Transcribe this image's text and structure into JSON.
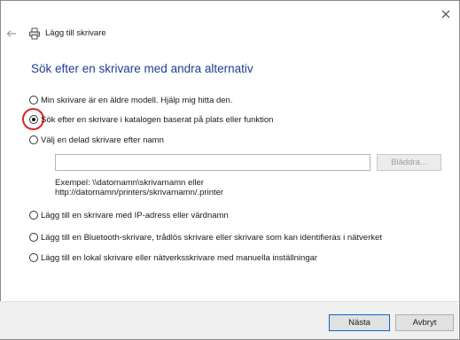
{
  "window": {
    "title": "Lägg till skrivare",
    "close_icon": "close-icon",
    "back_icon": "back-arrow-icon",
    "printer_icon": "printer-icon"
  },
  "heading": "Sök efter en skrivare med andra alternativ",
  "options": [
    {
      "label": "Min skrivare är en äldre modell. Hjälp mig hitta den.",
      "selected": false
    },
    {
      "label": "Sök efter en skrivare i katalogen baserat på plats eller funktion",
      "selected": true
    },
    {
      "label": "Välj en delad skrivare efter namn",
      "selected": false
    },
    {
      "label": "Lägg till en skrivare med IP-adress eller värdnamn",
      "selected": false
    },
    {
      "label": "Lägg till en Bluetooth-skrivare, trådlös skrivare eller skrivare som kan identifieras i nätverket",
      "selected": false
    },
    {
      "label": "Lägg till en lokal skrivare eller nätverksskrivare med manuella inställningar",
      "selected": false
    }
  ],
  "shared_printer": {
    "input_value": "",
    "browse_label": "Bläddra...",
    "example_line1": "Exempel: \\\\datornamn\\skrivarnamn eller",
    "example_line2": "http://datornamn/printers/skrivarnamn/.printer"
  },
  "buttons": {
    "next": "Nästa",
    "cancel": "Avbryt"
  },
  "colors": {
    "heading": "#1c3e8f",
    "highlight_ring": "#d9262a",
    "default_button_border": "#0a64c8"
  }
}
